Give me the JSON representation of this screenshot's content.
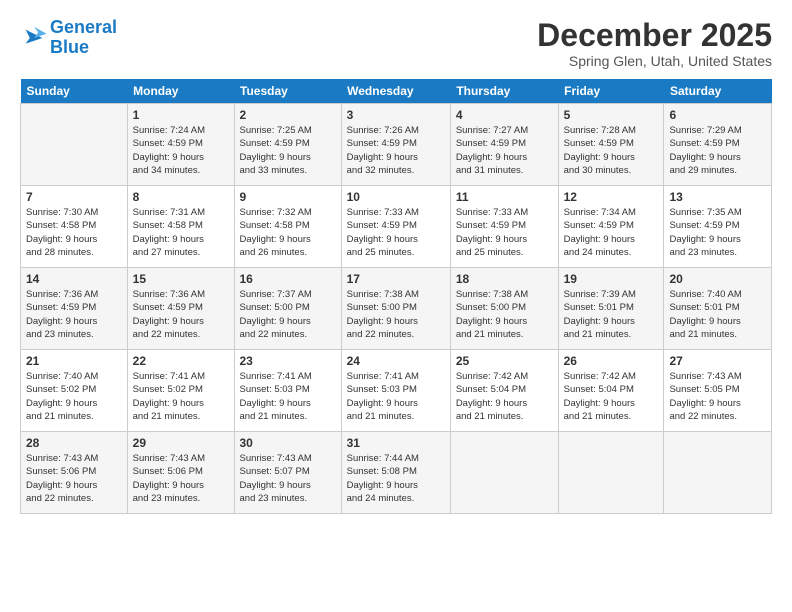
{
  "logo": {
    "line1": "General",
    "line2": "Blue"
  },
  "title": "December 2025",
  "subtitle": "Spring Glen, Utah, United States",
  "days_of_week": [
    "Sunday",
    "Monday",
    "Tuesday",
    "Wednesday",
    "Thursday",
    "Friday",
    "Saturday"
  ],
  "weeks": [
    [
      {
        "num": "",
        "info": ""
      },
      {
        "num": "1",
        "info": "Sunrise: 7:24 AM\nSunset: 4:59 PM\nDaylight: 9 hours\nand 34 minutes."
      },
      {
        "num": "2",
        "info": "Sunrise: 7:25 AM\nSunset: 4:59 PM\nDaylight: 9 hours\nand 33 minutes."
      },
      {
        "num": "3",
        "info": "Sunrise: 7:26 AM\nSunset: 4:59 PM\nDaylight: 9 hours\nand 32 minutes."
      },
      {
        "num": "4",
        "info": "Sunrise: 7:27 AM\nSunset: 4:59 PM\nDaylight: 9 hours\nand 31 minutes."
      },
      {
        "num": "5",
        "info": "Sunrise: 7:28 AM\nSunset: 4:59 PM\nDaylight: 9 hours\nand 30 minutes."
      },
      {
        "num": "6",
        "info": "Sunrise: 7:29 AM\nSunset: 4:59 PM\nDaylight: 9 hours\nand 29 minutes."
      }
    ],
    [
      {
        "num": "7",
        "info": "Sunrise: 7:30 AM\nSunset: 4:58 PM\nDaylight: 9 hours\nand 28 minutes."
      },
      {
        "num": "8",
        "info": "Sunrise: 7:31 AM\nSunset: 4:58 PM\nDaylight: 9 hours\nand 27 minutes."
      },
      {
        "num": "9",
        "info": "Sunrise: 7:32 AM\nSunset: 4:58 PM\nDaylight: 9 hours\nand 26 minutes."
      },
      {
        "num": "10",
        "info": "Sunrise: 7:33 AM\nSunset: 4:59 PM\nDaylight: 9 hours\nand 25 minutes."
      },
      {
        "num": "11",
        "info": "Sunrise: 7:33 AM\nSunset: 4:59 PM\nDaylight: 9 hours\nand 25 minutes."
      },
      {
        "num": "12",
        "info": "Sunrise: 7:34 AM\nSunset: 4:59 PM\nDaylight: 9 hours\nand 24 minutes."
      },
      {
        "num": "13",
        "info": "Sunrise: 7:35 AM\nSunset: 4:59 PM\nDaylight: 9 hours\nand 23 minutes."
      }
    ],
    [
      {
        "num": "14",
        "info": "Sunrise: 7:36 AM\nSunset: 4:59 PM\nDaylight: 9 hours\nand 23 minutes."
      },
      {
        "num": "15",
        "info": "Sunrise: 7:36 AM\nSunset: 4:59 PM\nDaylight: 9 hours\nand 22 minutes."
      },
      {
        "num": "16",
        "info": "Sunrise: 7:37 AM\nSunset: 5:00 PM\nDaylight: 9 hours\nand 22 minutes."
      },
      {
        "num": "17",
        "info": "Sunrise: 7:38 AM\nSunset: 5:00 PM\nDaylight: 9 hours\nand 22 minutes."
      },
      {
        "num": "18",
        "info": "Sunrise: 7:38 AM\nSunset: 5:00 PM\nDaylight: 9 hours\nand 21 minutes."
      },
      {
        "num": "19",
        "info": "Sunrise: 7:39 AM\nSunset: 5:01 PM\nDaylight: 9 hours\nand 21 minutes."
      },
      {
        "num": "20",
        "info": "Sunrise: 7:40 AM\nSunset: 5:01 PM\nDaylight: 9 hours\nand 21 minutes."
      }
    ],
    [
      {
        "num": "21",
        "info": "Sunrise: 7:40 AM\nSunset: 5:02 PM\nDaylight: 9 hours\nand 21 minutes."
      },
      {
        "num": "22",
        "info": "Sunrise: 7:41 AM\nSunset: 5:02 PM\nDaylight: 9 hours\nand 21 minutes."
      },
      {
        "num": "23",
        "info": "Sunrise: 7:41 AM\nSunset: 5:03 PM\nDaylight: 9 hours\nand 21 minutes."
      },
      {
        "num": "24",
        "info": "Sunrise: 7:41 AM\nSunset: 5:03 PM\nDaylight: 9 hours\nand 21 minutes."
      },
      {
        "num": "25",
        "info": "Sunrise: 7:42 AM\nSunset: 5:04 PM\nDaylight: 9 hours\nand 21 minutes."
      },
      {
        "num": "26",
        "info": "Sunrise: 7:42 AM\nSunset: 5:04 PM\nDaylight: 9 hours\nand 21 minutes."
      },
      {
        "num": "27",
        "info": "Sunrise: 7:43 AM\nSunset: 5:05 PM\nDaylight: 9 hours\nand 22 minutes."
      }
    ],
    [
      {
        "num": "28",
        "info": "Sunrise: 7:43 AM\nSunset: 5:06 PM\nDaylight: 9 hours\nand 22 minutes."
      },
      {
        "num": "29",
        "info": "Sunrise: 7:43 AM\nSunset: 5:06 PM\nDaylight: 9 hours\nand 23 minutes."
      },
      {
        "num": "30",
        "info": "Sunrise: 7:43 AM\nSunset: 5:07 PM\nDaylight: 9 hours\nand 23 minutes."
      },
      {
        "num": "31",
        "info": "Sunrise: 7:44 AM\nSunset: 5:08 PM\nDaylight: 9 hours\nand 24 minutes."
      },
      {
        "num": "",
        "info": ""
      },
      {
        "num": "",
        "info": ""
      },
      {
        "num": "",
        "info": ""
      }
    ]
  ]
}
